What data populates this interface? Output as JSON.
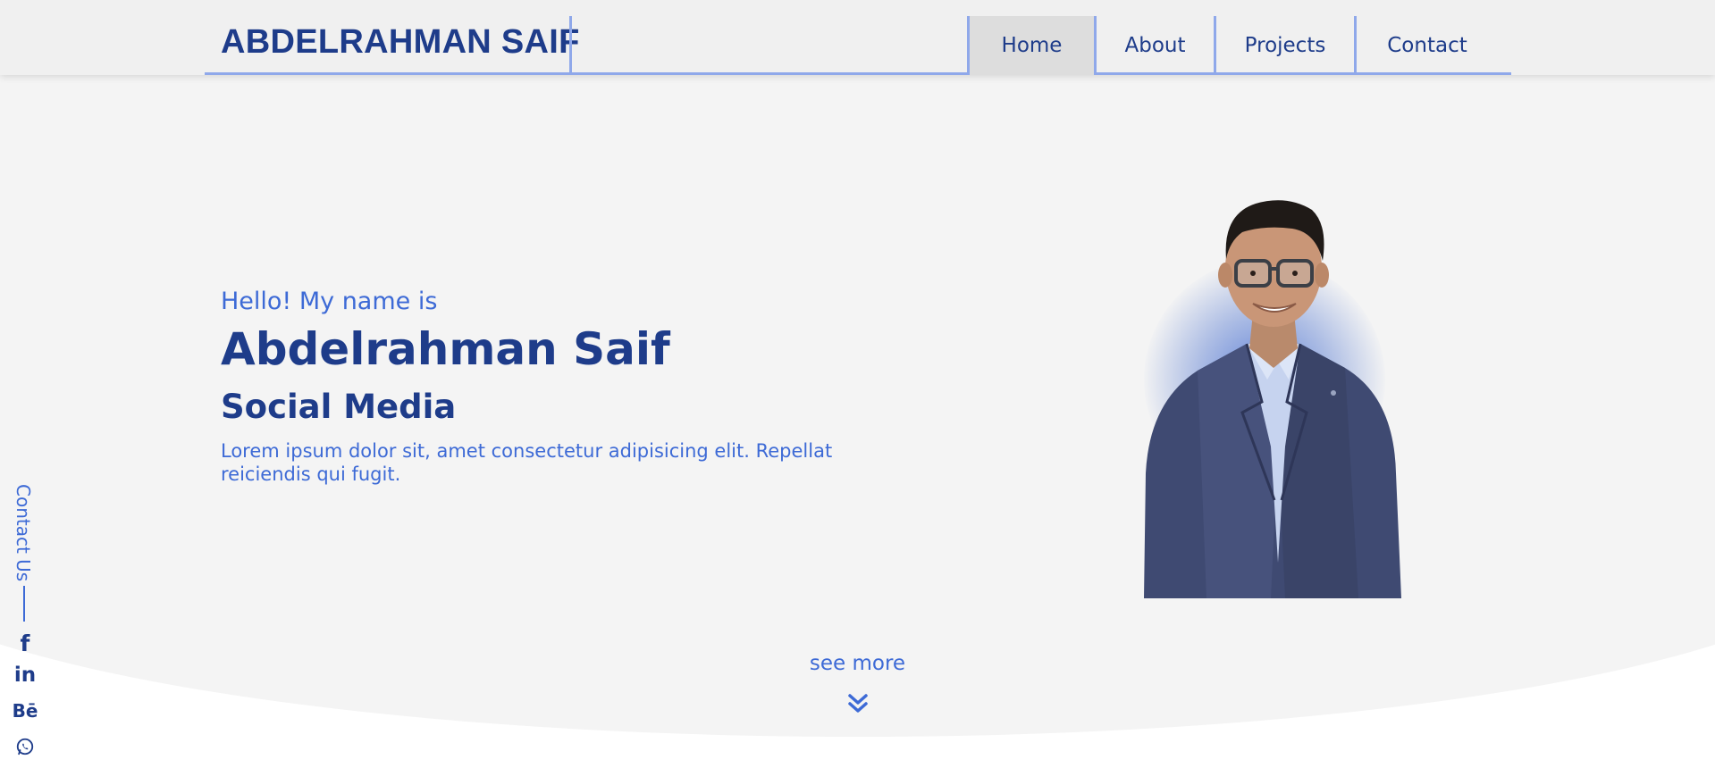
{
  "header": {
    "logo": "ABDELRAHMAN SAIF",
    "nav": [
      {
        "label": "Home",
        "active": true
      },
      {
        "label": "About",
        "active": false
      },
      {
        "label": "Projects",
        "active": false
      },
      {
        "label": "Contact",
        "active": false
      }
    ]
  },
  "hero": {
    "greeting": "Hello! My name is",
    "name": "Abdelrahman Saif",
    "role": "Social Media",
    "description": "Lorem ipsum dolor sit, amet consectetur adipisicing elit. Repellat reiciendis qui fugit."
  },
  "see_more": {
    "label": "see more",
    "icon": "double-chevron-down-icon"
  },
  "sidebar": {
    "contact_label": "Contact Us",
    "socials": [
      {
        "name": "facebook-icon",
        "glyph": "f"
      },
      {
        "name": "linkedin-icon",
        "glyph": "in"
      },
      {
        "name": "behance-icon",
        "glyph": "Bē"
      },
      {
        "name": "whatsapp-icon",
        "glyph": ""
      }
    ]
  },
  "colors": {
    "primary_dark": "#1e3c8a",
    "accent": "#3d6ad6",
    "border": "#8fa8ea",
    "background": "#f4f4f4"
  }
}
